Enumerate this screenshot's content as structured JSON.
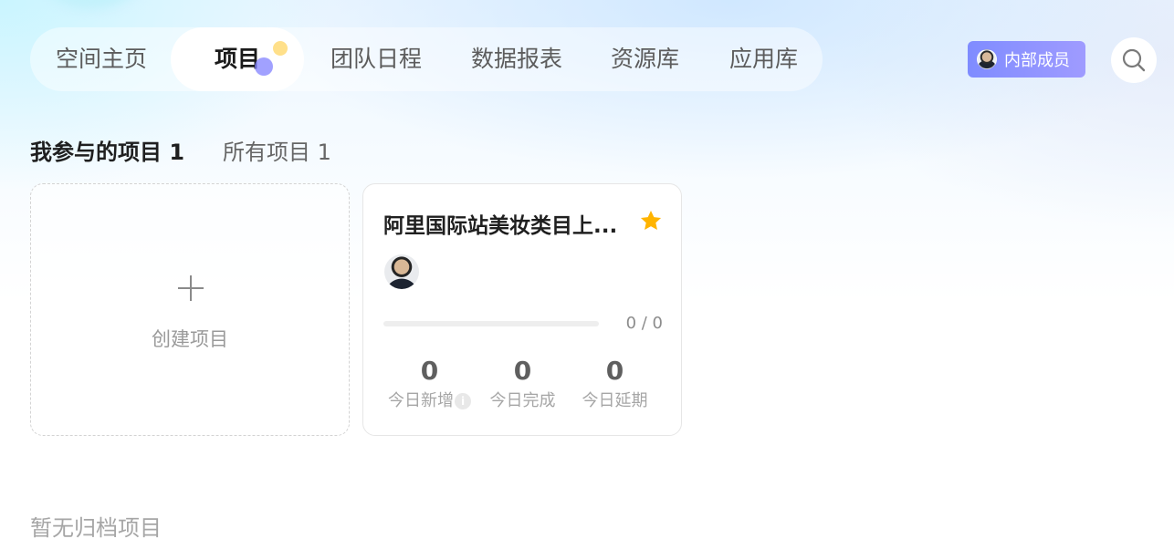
{
  "nav": {
    "tabs": [
      {
        "label": "空间主页"
      },
      {
        "label": "项目"
      },
      {
        "label": "团队日程"
      },
      {
        "label": "数据报表"
      },
      {
        "label": "资源库"
      },
      {
        "label": "应用库"
      }
    ],
    "active_index": 1,
    "member_badge": {
      "label": "内部成员",
      "icon": "avatar"
    },
    "search_icon": "search-icon"
  },
  "section_tabs": [
    {
      "label": "我参与的项目 1",
      "active": true
    },
    {
      "label": "所有项目 1",
      "active": false
    }
  ],
  "create_card": {
    "icon": "plus-icon",
    "label": "创建项目"
  },
  "project_card": {
    "title": "阿里国际站美妆类目上...",
    "starred": true,
    "progress_text": "0 / 0",
    "progress_fraction": 0,
    "stats": [
      {
        "value": "0",
        "label": "今日新增",
        "has_info": true
      },
      {
        "value": "0",
        "label": "今日完成",
        "has_info": false
      },
      {
        "value": "0",
        "label": "今日延期",
        "has_info": false
      }
    ]
  },
  "archive": {
    "empty_text": "暂无归档项目"
  },
  "colors": {
    "accent": "#7f8cff",
    "star": "#ffb400",
    "nav_text": "#5c5c5c"
  }
}
